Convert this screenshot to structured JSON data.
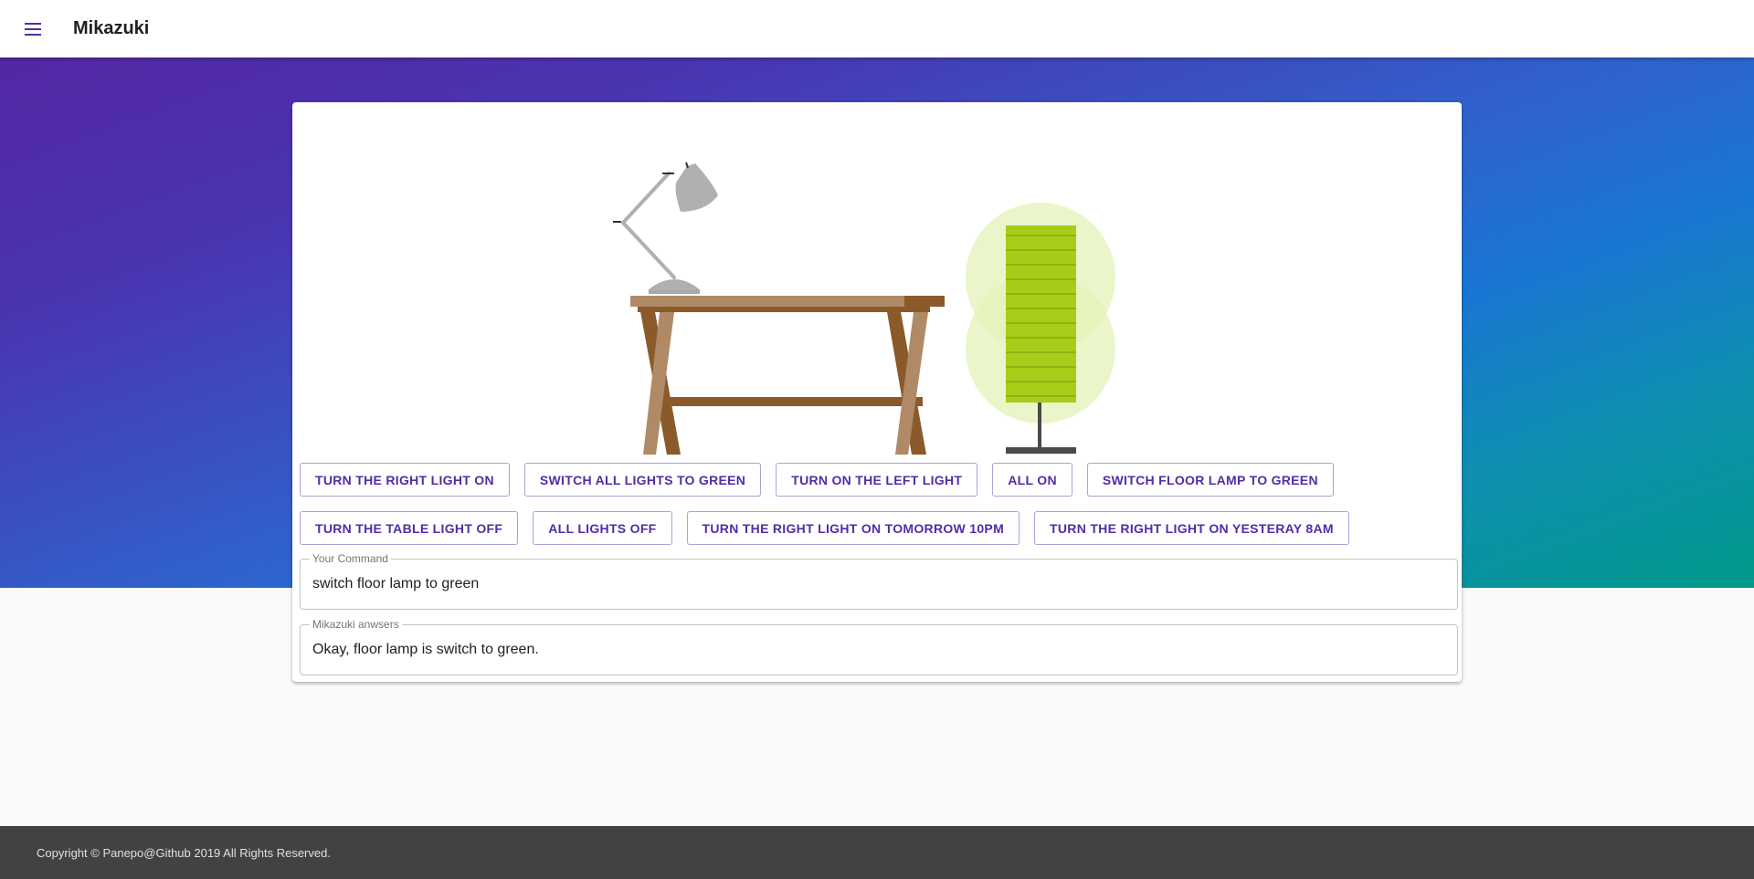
{
  "app_bar": {
    "title": "Mikazuki",
    "menu_icon": "menu-icon"
  },
  "scene": {
    "desk_lamp_icon": "desk-lamp-icon",
    "table_icon": "table-icon",
    "floor_lamp_icon": "floor-lamp-icon",
    "floor_lamp_color": "#a6ce19",
    "floor_lamp_glow": "#e4f2b8",
    "desk_lamp_color": "#b0b0b0"
  },
  "commands": {
    "row1": [
      "Turn the right light on",
      "Switch all lights to green",
      "Turn on the left light",
      "All on",
      "Switch floor lamp to green"
    ],
    "row2": [
      "Turn the table light off",
      "All lights off",
      "Turn the right light on tomorrow 10pm",
      "Turn the right light on yesteray 8am"
    ]
  },
  "command_field": {
    "label": "Your Command",
    "value": "switch floor lamp to green"
  },
  "answer_field": {
    "label": "Mikazuki anwsers",
    "value": "Okay, floor lamp is switch to green."
  },
  "footer": {
    "text": "Copyright © Panepo@Github 2019 All Rights Reserved."
  },
  "colors": {
    "primary": "#512da8",
    "footer_bg": "#424242"
  }
}
